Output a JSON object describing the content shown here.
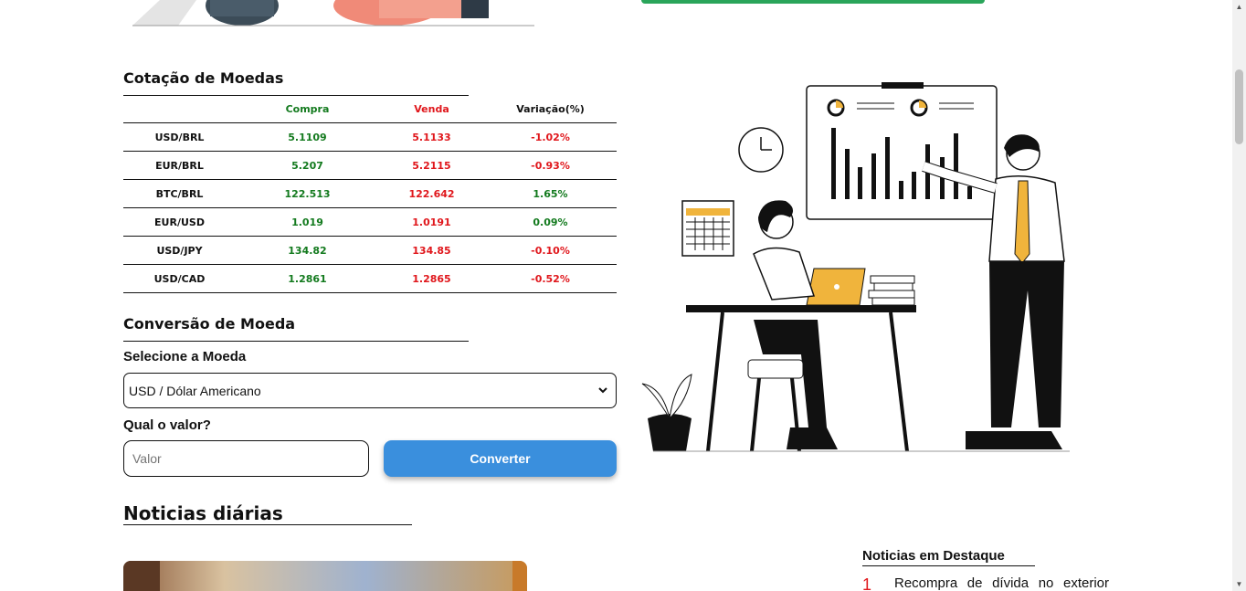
{
  "quotes": {
    "title": "Cotação de Moedas",
    "headers": [
      "",
      "Compra",
      "Venda",
      "Variação(%)"
    ],
    "rows": [
      {
        "pair": "USD/BRL",
        "buy": "5.1109",
        "sell": "5.1133",
        "change": "-1.02%",
        "change_trend": "down"
      },
      {
        "pair": "EUR/BRL",
        "buy": "5.207",
        "sell": "5.2115",
        "change": "-0.93%",
        "change_trend": "down"
      },
      {
        "pair": "BTC/BRL",
        "buy": "122.513",
        "sell": "122.642",
        "change": "1.65%",
        "change_trend": "up"
      },
      {
        "pair": "EUR/USD",
        "buy": "1.019",
        "sell": "1.0191",
        "change": "0.09%",
        "change_trend": "up"
      },
      {
        "pair": "USD/JPY",
        "buy": "134.82",
        "sell": "134.85",
        "change": "-0.10%",
        "change_trend": "down"
      },
      {
        "pair": "USD/CAD",
        "buy": "1.2861",
        "sell": "1.2865",
        "change": "-0.52%",
        "change_trend": "down"
      }
    ]
  },
  "converter": {
    "title": "Conversão de Moeda",
    "select_label": "Selecione a Moeda",
    "selected_currency": "USD / Dólar Americano",
    "value_label": "Qual o valor?",
    "value_placeholder": "Valor",
    "convert_button": "Converter"
  },
  "news": {
    "title": "Noticias diárias"
  },
  "featured": {
    "title": "Noticias em Destaque",
    "items": [
      {
        "number": "1",
        "text": "Recompra de dívida no exterior"
      }
    ]
  },
  "colors": {
    "buy": "#137a1e",
    "sell": "#e0171c",
    "button": "#3a8fdd",
    "accent_yellow": "#f0b43c"
  }
}
